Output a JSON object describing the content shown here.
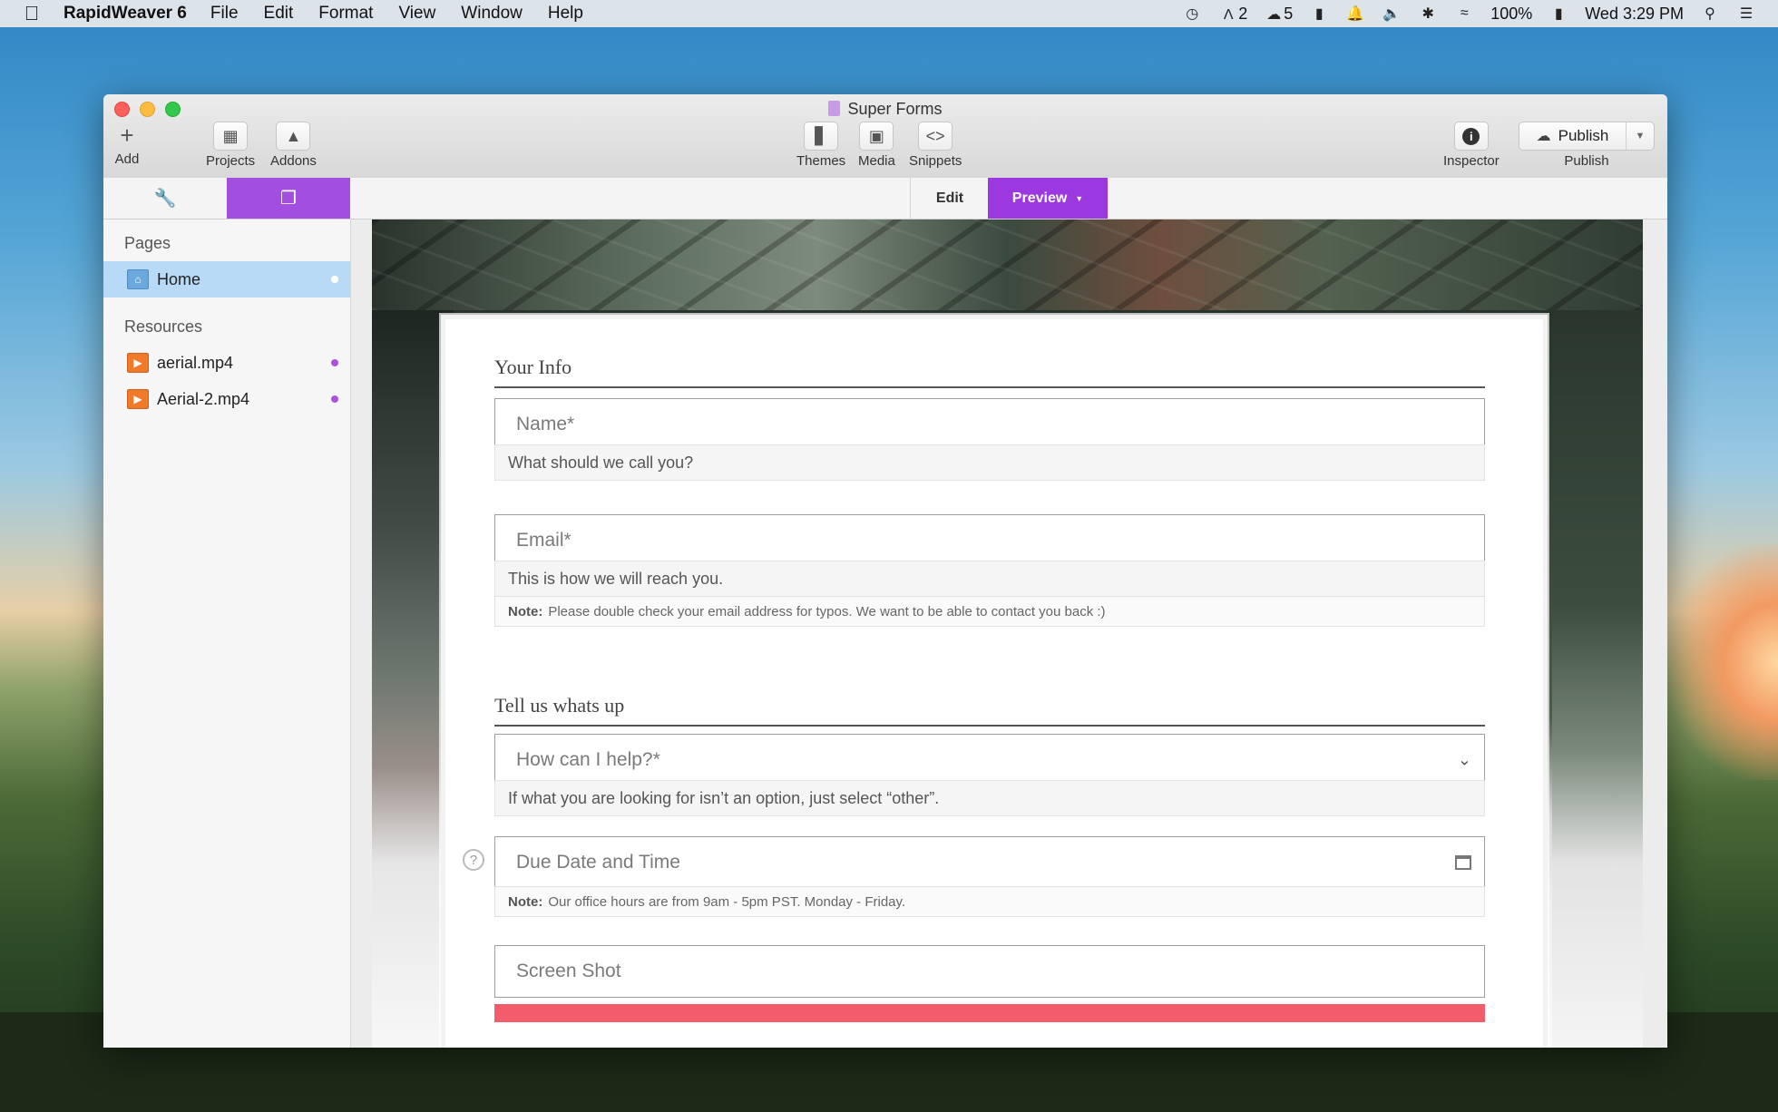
{
  "menubar": {
    "app_name": "RapidWeaver 6",
    "items": [
      "File",
      "Edit",
      "Format",
      "View",
      "Window",
      "Help"
    ],
    "tray": {
      "adobe_count": "2",
      "cc_count": "5",
      "battery": "100%",
      "clock": "Wed 3:29 PM"
    }
  },
  "window": {
    "title": "Super Forms",
    "toolbar": {
      "add": "Add",
      "projects": "Projects",
      "addons": "Addons",
      "themes": "Themes",
      "media": "Media",
      "snippets": "Snippets",
      "inspector": "Inspector",
      "publish_button": "Publish",
      "publish_caption": "Publish"
    },
    "subbar": {
      "edit": "Edit",
      "preview": "Preview"
    }
  },
  "sidebar": {
    "pages_heading": "Pages",
    "pages": [
      {
        "label": "Home"
      }
    ],
    "resources_heading": "Resources",
    "resources": [
      {
        "label": "aerial.mp4"
      },
      {
        "label": "Aerial-2.mp4"
      }
    ]
  },
  "form": {
    "section1_title": "Your Info",
    "name_placeholder": "Name*",
    "name_help": "What should we call you?",
    "email_placeholder": "Email*",
    "email_help": "This is how we will reach you.",
    "email_note_label": "Note:",
    "email_note": "Please double check your email address for typos. We want to be able to contact you back :)",
    "section2_title": "Tell us whats up",
    "help_select": "How can I help?*",
    "help_select_help": "If what you are looking for isn’t an option, just select “other”.",
    "due_placeholder": "Due Date and Time",
    "due_note_label": "Note:",
    "due_note": "Our office hours are from 9am - 5pm PST. Monday - Friday.",
    "screenshot_placeholder": "Screen Shot",
    "question_mark": "?"
  },
  "colors": {
    "accent_purple": "#9b38e0",
    "selection_blue": "#b9daf7",
    "submit_red": "#f35d6b"
  }
}
